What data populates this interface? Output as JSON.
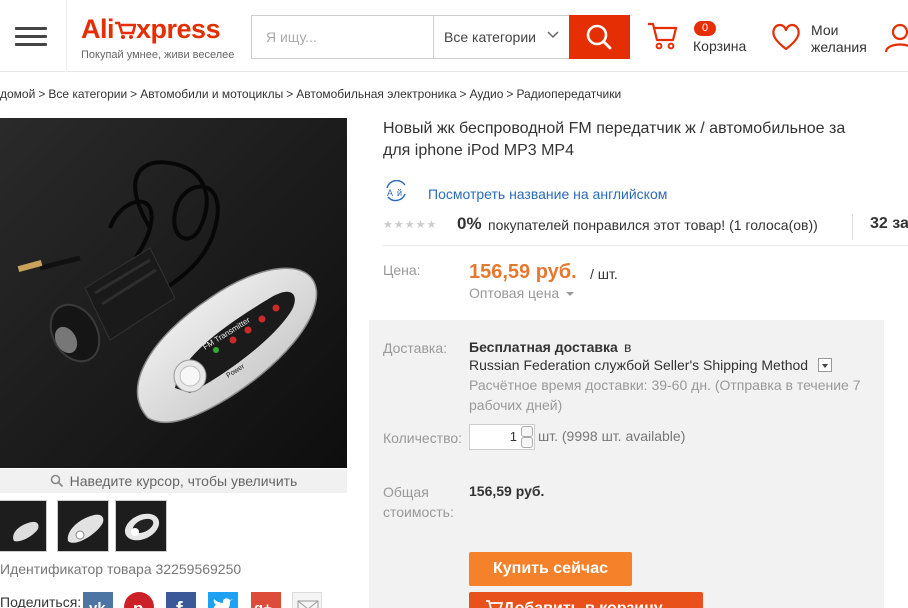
{
  "header": {
    "logo_text_left": "Ali",
    "logo_text_right": "xpress",
    "slogan": "Покупай умнее, живи веселее",
    "search_placeholder": "Я ищу...",
    "category_select": "Все категории",
    "cart_count": "0",
    "cart_label": "Корзина",
    "wishlist_label_1": "Мои",
    "wishlist_label_2": "желания"
  },
  "breadcrumb": [
    "домой",
    "Все категории",
    "Автомобили и мотоциклы",
    "Автомобильная электроника",
    "Аудио",
    "Радиопередатчики"
  ],
  "gallery": {
    "zoom_hint": "Наведите курсор, чтобы увеличить",
    "product_id_label": "Идентификатор товара 32259569250",
    "share_label": "Поделиться:",
    "share_icons": [
      "vk-icon",
      "pinterest-icon",
      "facebook-icon",
      "twitter-icon",
      "google-plus-icon",
      "email-icon"
    ],
    "device_text": "FM Transmitter",
    "device_power": "Power"
  },
  "product": {
    "title_line_1": "Новый жк беспроводной FM передатчик ж / автомобильное за",
    "title_line_2": "для iphone iPod MP3 MP4",
    "translate_link": "Посмотреть название на английском",
    "rating_pct": "0%",
    "rating_text": "покупателей понравился этот товар! (1 голоса(ов))",
    "orders": "32 за",
    "price_label": "Цена:",
    "price": "156,59 руб.",
    "price_unit": "/ шт.",
    "wholesale": "Оптовая цена",
    "shipping_label": "Доставка:",
    "shipping_free": "Бесплатная доставка",
    "shipping_in": "в",
    "shipping_method": "Russian Federation службой Seller's Shipping Method",
    "shipping_time": "Расчётное время доставки: 39-60 дн. (Отправка в течение 7 рабочих дней)",
    "qty_label": "Количество:",
    "qty_value": "1",
    "qty_avail": "шт. (9998 шт. available)",
    "total_label": "Общая стоимость:",
    "total": "156,59 руб.",
    "buy_now": "Купить сейчас",
    "add_to_cart": "Добавить в корзину"
  },
  "colors": {
    "brand": "#e62e04",
    "price": "#e6792f",
    "link": "#2b6bb8",
    "buy": "#f5822a"
  }
}
